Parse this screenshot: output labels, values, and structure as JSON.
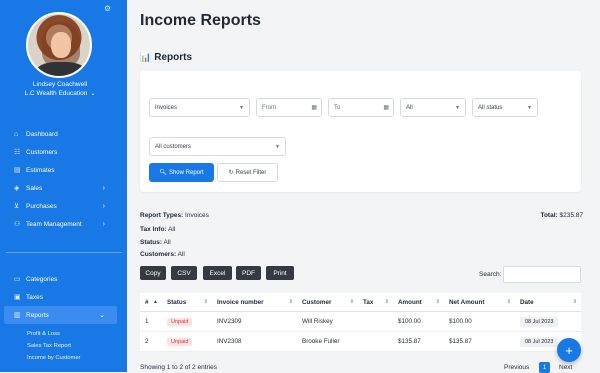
{
  "sidebar": {
    "user_name": "Lindsey Coachwell",
    "company": "L.C Wealth Education",
    "nav": [
      {
        "label": "Dashboard",
        "icon": "home-icon"
      },
      {
        "label": "Customers",
        "icon": "users-icon"
      },
      {
        "label": "Estimates",
        "icon": "document-icon"
      },
      {
        "label": "Sales",
        "icon": "tag-icon"
      },
      {
        "label": "Purchases",
        "icon": "cart-icon"
      },
      {
        "label": "Team Management",
        "icon": "team-icon"
      }
    ],
    "nav2": [
      {
        "label": "Categories",
        "icon": "folder-icon"
      },
      {
        "label": "Taxes",
        "icon": "tax-icon"
      },
      {
        "label": "Reports",
        "icon": "reports-icon"
      }
    ],
    "sub": [
      "Profit & Loss",
      "Sales Tax Report",
      "Income by Customer"
    ]
  },
  "page": {
    "title": "Income Reports",
    "section": "Reports"
  },
  "filters": {
    "type": "Invoices",
    "from_placeholder": "From",
    "to_placeholder": "To",
    "tax": "All",
    "status": "All status",
    "customer": "All customers",
    "show_label": "Show Report",
    "reset_label": "Reset Filter"
  },
  "summary": {
    "report_types_label": "Report Types:",
    "report_types": "Invoices",
    "tax_info_label": "Tax Info:",
    "tax_info": "All",
    "status_label": "Status:",
    "status": "All",
    "customers_label": "Customers:",
    "customers": "All",
    "total_label": "Total:",
    "total": "$235.87"
  },
  "export": [
    "Copy",
    "CSV",
    "Excel",
    "PDF",
    "Print"
  ],
  "search_label": "Search:",
  "table": {
    "headers": [
      "#",
      "Status",
      "Invoice number",
      "Customer",
      "Tax",
      "Amount",
      "Net Amount",
      "Date"
    ],
    "rows": [
      [
        "1",
        "Unpaid",
        "INV2309",
        "Will Riskey",
        "",
        "$100.00",
        "$100.00",
        "08 Jul 2023"
      ],
      [
        "2",
        "Unpaid",
        "INV2308",
        "Brooke Fuller",
        "",
        "$135.87",
        "$135.87",
        "08 Jul 2023"
      ]
    ]
  },
  "footer": {
    "showing": "Showing 1 to 2 of 2 entries",
    "previous": "Previous",
    "current": "1",
    "next": "Next"
  },
  "colors": {
    "accent": "#1778e6",
    "unpaid_bg": "#fde2e2",
    "unpaid_text": "#d33c3c"
  }
}
